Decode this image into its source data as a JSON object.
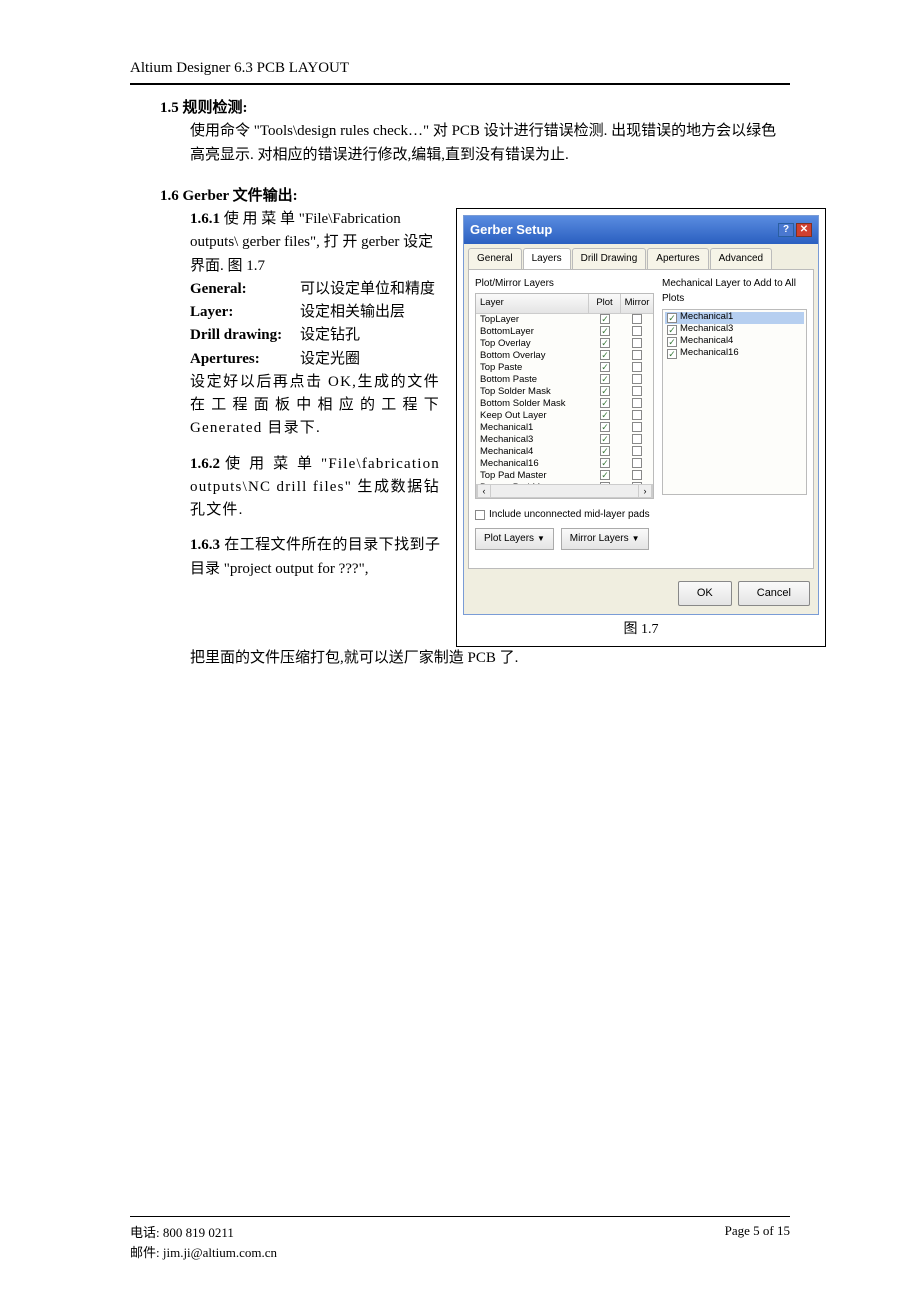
{
  "header": "Altium Designer 6.3 PCB LAYOUT",
  "s15": {
    "title": "1.5 规则检测:",
    "body": "使用命令 \"Tools\\design rules check…\" 对 PCB 设计进行错误检测. 出现错误的地方会以绿色高亮显示. 对相应的错误进行修改,编辑,直到没有错误为止."
  },
  "s16": {
    "title": "1.6 Gerber 文件输出:",
    "p161a": "1.6.1",
    "p161a_text": "使 用 菜 单  \"File\\Fabrication outputs\\ gerber files\", 打 开 gerber 设定界面.  图 1.7",
    "general_label": "General:",
    "general_text": "可以设定单位和精度",
    "layer_label": "Layer:",
    "layer_text": "设定相关输出层",
    "drill_label": "Drill drawing:",
    "drill_text": "设定钻孔",
    "apertures_label": "Apertures:",
    "apertures_text": "设定光圈",
    "after": "设定好以后再点击 OK,生成的文件在 工 程 面 板 中 相 应 的 工 程 下Generated  目录下.",
    "p162": "1.6.2",
    "p162_text": "使 用 菜 单  \"File\\fabrication outputs\\NC drill files\" 生成数据钻孔文件.",
    "p163": "1.6.3",
    "p163_text_a": "在工程文件所在的目录下找到子目录 \"project output for ???\",",
    "p163_text_b": "把里面的文件压缩打包,就可以送厂家制造 PCB 了."
  },
  "dialog": {
    "title": "Gerber Setup",
    "tabs": [
      "General",
      "Layers",
      "Drill Drawing",
      "Apertures",
      "Advanced"
    ],
    "active_tab": "Layers",
    "left_panel_title": "Plot/Mirror Layers",
    "right_panel_title": "Mechanical Layer to Add to All Plots",
    "cols": {
      "layer": "Layer",
      "plot": "Plot",
      "mirror": "Mirror"
    },
    "layers": [
      {
        "name": "TopLayer",
        "plot": true,
        "mirror": false
      },
      {
        "name": "BottomLayer",
        "plot": true,
        "mirror": false
      },
      {
        "name": "Top Overlay",
        "plot": true,
        "mirror": false
      },
      {
        "name": "Bottom Overlay",
        "plot": true,
        "mirror": false
      },
      {
        "name": "Top Paste",
        "plot": true,
        "mirror": false
      },
      {
        "name": "Bottom Paste",
        "plot": true,
        "mirror": false
      },
      {
        "name": "Top Solder Mask",
        "plot": true,
        "mirror": false
      },
      {
        "name": "Bottom Solder Mask",
        "plot": true,
        "mirror": false
      },
      {
        "name": "Keep Out Layer",
        "plot": true,
        "mirror": false
      },
      {
        "name": "Mechanical1",
        "plot": true,
        "mirror": false
      },
      {
        "name": "Mechanical3",
        "plot": true,
        "mirror": false
      },
      {
        "name": "Mechanical4",
        "plot": true,
        "mirror": false
      },
      {
        "name": "Mechanical16",
        "plot": true,
        "mirror": false
      },
      {
        "name": "Top Pad Master",
        "plot": true,
        "mirror": false
      },
      {
        "name": "Bottom Pad Master",
        "plot": true,
        "mirror": false
      }
    ],
    "mech_layers": [
      {
        "name": "Mechanical1",
        "checked": true,
        "selected": true
      },
      {
        "name": "Mechanical3",
        "checked": true,
        "selected": false
      },
      {
        "name": "Mechanical4",
        "checked": true,
        "selected": false
      },
      {
        "name": "Mechanical16",
        "checked": true,
        "selected": false
      }
    ],
    "include_unconnected": "Include unconnected mid-layer pads",
    "plot_layers_btn": "Plot Layers",
    "mirror_layers_btn": "Mirror Layers",
    "ok": "OK",
    "cancel": "Cancel"
  },
  "figure_caption": "图 1.7",
  "footer": {
    "phone": "电话: 800 819 0211",
    "email": "邮件: jim.ji@altium.com.cn",
    "page": "Page 5 of 15"
  }
}
